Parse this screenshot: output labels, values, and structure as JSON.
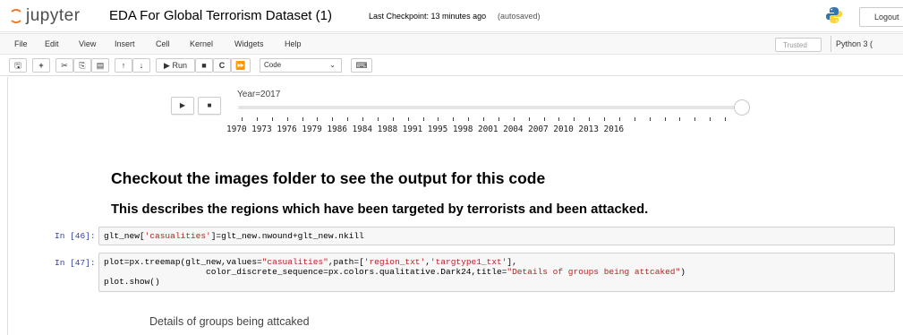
{
  "header": {
    "brand": "jupyter",
    "notebook_title": "EDA For Global Terrorism Dataset (1)",
    "checkpoint": "Last Checkpoint: 13 minutes ago",
    "autosave": "(autosaved)",
    "logout_label": "Logout",
    "logo_icon": "jupyter-logo-icon",
    "python_icon": "python-logo-icon"
  },
  "menubar": {
    "items": [
      "File",
      "Edit",
      "View",
      "Insert",
      "Cell",
      "Kernel",
      "Widgets",
      "Help"
    ],
    "trusted_label": "Trusted",
    "kernel_label": "Python 3 ("
  },
  "toolbar": {
    "run_label": "▶ Run",
    "cell_type": "Code",
    "icons": [
      "save-icon",
      "plus-icon",
      "cut-icon",
      "copy-icon",
      "paste-icon",
      "move-up-icon",
      "move-down-icon",
      "run-icon",
      "stop-icon",
      "restart-icon",
      "fast-forward-icon",
      "keyboard-icon"
    ]
  },
  "slider": {
    "label": "Year=2017",
    "value": 2017,
    "play_glyph": "▶",
    "stop_glyph": "■",
    "tick_labels_text": "1970 1973 1976 1979 1986 1984 1988 1991 1995 1998 2001 2004 2007 2010 2013 2016"
  },
  "markdown": {
    "heading1": "Checkout the images folder to see the output for this code",
    "heading2": "This describes the regions which have been targeted by terrorists and been attacked."
  },
  "cells": [
    {
      "prompt": "In [46]:",
      "code_parts": [
        "glt_new[",
        "'casualities'",
        "]=glt_new.nwound+glt_new.nkill"
      ]
    },
    {
      "prompt": "In [47]:",
      "line1_parts": [
        "plot=px.treemap(glt_new,values=",
        "\"casualities\"",
        ",path=[",
        "'region_txt'",
        ",",
        "'targtype1_txt'",
        "],"
      ],
      "line2_parts": [
        "                    color_discrete_sequence=px.colors.qualitative.Dark24,title=",
        "\"Details of groups being attcaked\"",
        ")"
      ],
      "line3": "plot.show()"
    }
  ],
  "output": {
    "title": "Details of groups being attcaked"
  }
}
